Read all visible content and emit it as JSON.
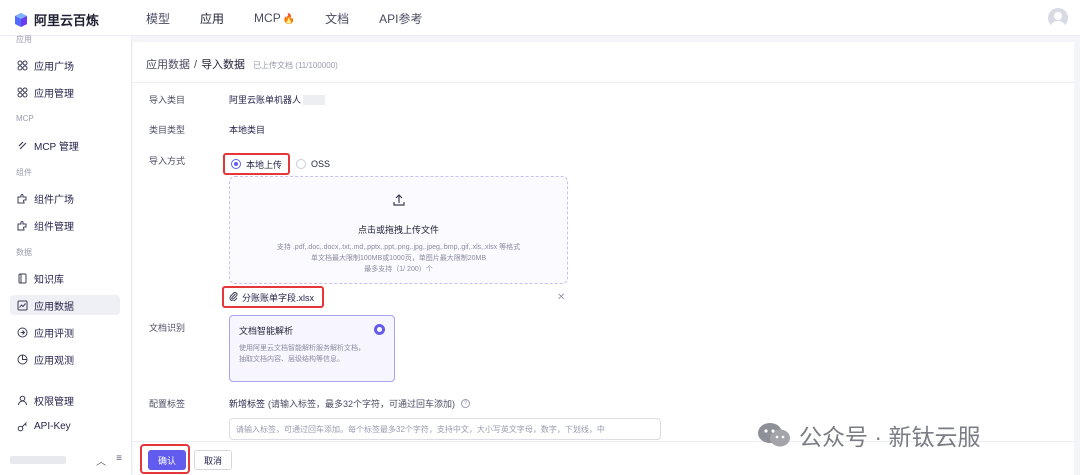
{
  "brand": {
    "name": "阿里云百炼"
  },
  "nav": {
    "items": [
      {
        "label": "模型"
      },
      {
        "label": "应用"
      },
      {
        "label": "MCP"
      },
      {
        "label": "文档"
      },
      {
        "label": "API参考"
      }
    ]
  },
  "sidebar": {
    "sections": {
      "app": "应用",
      "mcp": "MCP",
      "component": "组件",
      "data": "数据"
    },
    "items": [
      {
        "label": "应用广场",
        "icon": "grid-icon"
      },
      {
        "label": "应用管理",
        "icon": "grid-icon"
      },
      {
        "label": "MCP 管理",
        "icon": "mcp-icon"
      },
      {
        "label": "组件广场",
        "icon": "puzzle-icon"
      },
      {
        "label": "组件管理",
        "icon": "puzzle-icon"
      },
      {
        "label": "知识库",
        "icon": "book-icon"
      },
      {
        "label": "应用数据",
        "icon": "chart-icon",
        "active": true
      },
      {
        "label": "应用评测",
        "icon": "target-icon"
      },
      {
        "label": "应用观测",
        "icon": "pie-icon"
      },
      {
        "label": "权限管理",
        "icon": "user-icon"
      },
      {
        "label": "API-Key",
        "icon": "key-icon"
      }
    ]
  },
  "breadcrumb": {
    "parent": "应用数据",
    "separator": "/",
    "current": "导入数据",
    "count": "已上传文档 (11/100000)"
  },
  "form": {
    "category_label": "导入类目",
    "category_value": "阿里云账单机器人",
    "type_label": "类目类型",
    "type_value": "本地类目",
    "method_label": "导入方式",
    "method_options": [
      "本地上传",
      "OSS"
    ],
    "method_selected": "本地上传",
    "upload": {
      "title": "点击或拖拽上传文件",
      "desc1": "支持 .pdf,.doc,.docx,.txt,.md,.pptx,.ppt,.png,.jpg,.jpeg,.bmp,.gif,.xls,.xlsx 等格式",
      "desc2": "单文档最大限制100MB或1000页，单图片最大限制20MB",
      "desc3": "最多支持（1/ 200）个"
    },
    "file": {
      "name": "分账账单字段.xlsx"
    },
    "doc_label": "文档识别",
    "doc_option": {
      "title": "文档智能解析",
      "desc": "使用阿里云文档智能解析服务解析文档，抽取文档内容、层级结构等信息。"
    },
    "tag_label": "配置标签",
    "tag_hint_bold": "新增标签",
    "tag_hint": "(请输入标签，最多32个字符，可通过回车添加)",
    "tag_placeholder": "请输入标签，可通过回车添加。每个标签最多32个字符，支持中文，大小写英文字母，数字，下划线，中"
  },
  "actions": {
    "confirm": "确认",
    "cancel": "取消"
  },
  "watermark": {
    "text": "公众号 · 新钛云服"
  },
  "colors": {
    "primary": "#615ced",
    "highlight": "#e6363a"
  }
}
